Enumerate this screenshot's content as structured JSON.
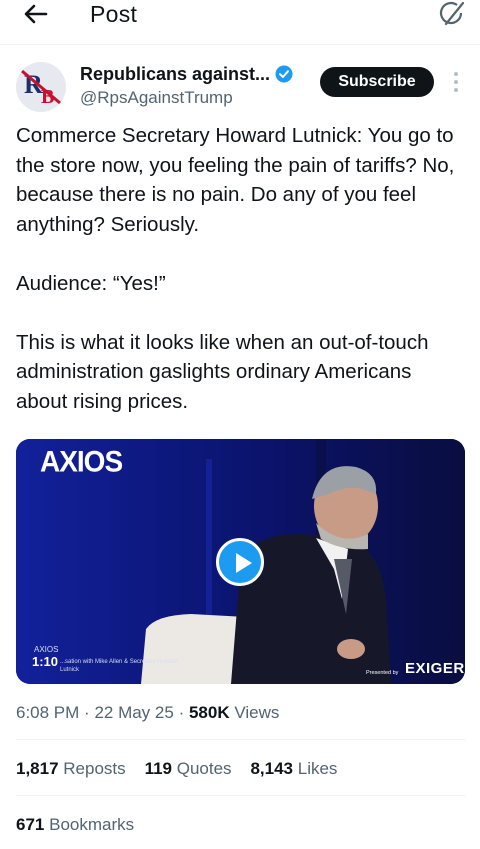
{
  "header": {
    "title": "Post",
    "back_icon": "arrow-left-icon",
    "grok_icon": "grok-icon"
  },
  "author": {
    "name": "Republicans against...",
    "handle": "@RpsAgainstTrump",
    "verified": true,
    "avatar_text": "RB",
    "subscribe_label": "Subscribe"
  },
  "tweet": {
    "paragraphs": [
      "Commerce Secretary Howard Lutnick: You go to the store now, you feeling the pain of tariffs? No, because there is no pain. Do any of you feel anything? Seriously.",
      "Audience: “Yes!”",
      "This is what it looks like when an out-of-touch administration gaslights ordinary Americans about rising prices."
    ]
  },
  "video": {
    "logo": "AXIOS",
    "caption_brand": "AXIOS",
    "duration": "1:10",
    "caption": "...sation with Mike Allen & Secretary Howard Lutnick",
    "sponsor_label": "Presented by",
    "sponsor": "EXIGER"
  },
  "meta": {
    "time": "6:08 PM",
    "date": "22 May 25",
    "views_count": "580K",
    "views_label": "Views"
  },
  "stats": {
    "reposts_count": "1,817",
    "reposts_label": "Reposts",
    "quotes_count": "119",
    "quotes_label": "Quotes",
    "likes_count": "8,143",
    "likes_label": "Likes",
    "bookmarks_count": "671",
    "bookmarks_label": "Bookmarks"
  },
  "colors": {
    "accent": "#1d9bf0",
    "text": "#0f1419",
    "secondary": "#536471",
    "video_bg": "#0f1a6b"
  }
}
